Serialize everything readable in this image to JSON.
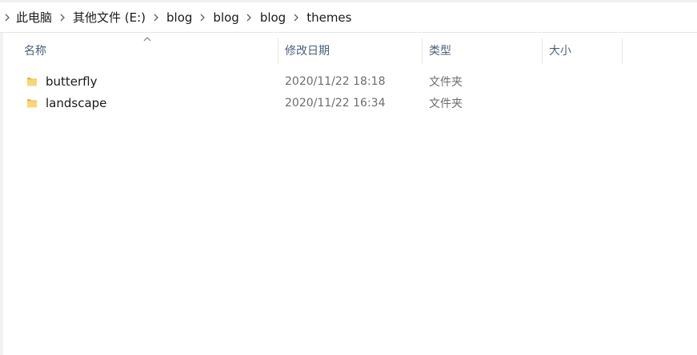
{
  "breadcrumb": {
    "items": [
      "此电脑",
      "其他文件 (E:)",
      "blog",
      "blog",
      "blog",
      "themes"
    ]
  },
  "columns": {
    "name": "名称",
    "date": "修改日期",
    "type": "类型",
    "size": "大小",
    "sorted_by": "name",
    "sort_direction": "ascending"
  },
  "files": [
    {
      "name": "butterfly",
      "modified": "2020/11/22 18:18",
      "type": "文件夹",
      "size": "",
      "icon": "folder-icon"
    },
    {
      "name": "landscape",
      "modified": "2020/11/22 16:34",
      "type": "文件夹",
      "size": "",
      "icon": "folder-icon"
    }
  ],
  "colors": {
    "header_text": "#4c607a",
    "folder": "#f8d775",
    "meta_text": "#6d6d6d"
  }
}
